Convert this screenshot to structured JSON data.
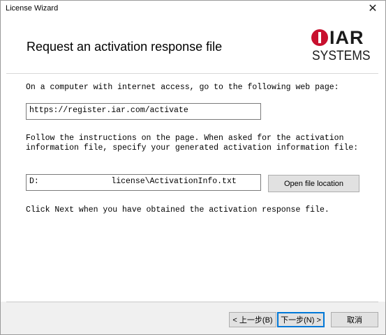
{
  "window": {
    "title": "License Wizard",
    "close_glyph": "✕"
  },
  "header": {
    "title": "Request an activation response file",
    "logo_top": "IAR",
    "logo_bottom": "SYSTEMS"
  },
  "body": {
    "intro_text": "On a computer with internet access, go to the following web page:",
    "url_value": "https://register.iar.com/activate",
    "instructions_line1": "Follow the instructions on the page. When asked for the activation",
    "instructions_line2": "information file, specify your generated activation information file:",
    "file_path_value": "D:               license\\ActivationInfo.txt",
    "open_location_label": "Open file location",
    "next_hint": "Click Next when you have obtained the activation response file."
  },
  "footer": {
    "back_label": "< 上一步(B)",
    "next_label": "下一步(N) >",
    "cancel_label": "取消"
  },
  "colors": {
    "brand_red": "#c8102e",
    "default_button_border": "#0078d7"
  }
}
